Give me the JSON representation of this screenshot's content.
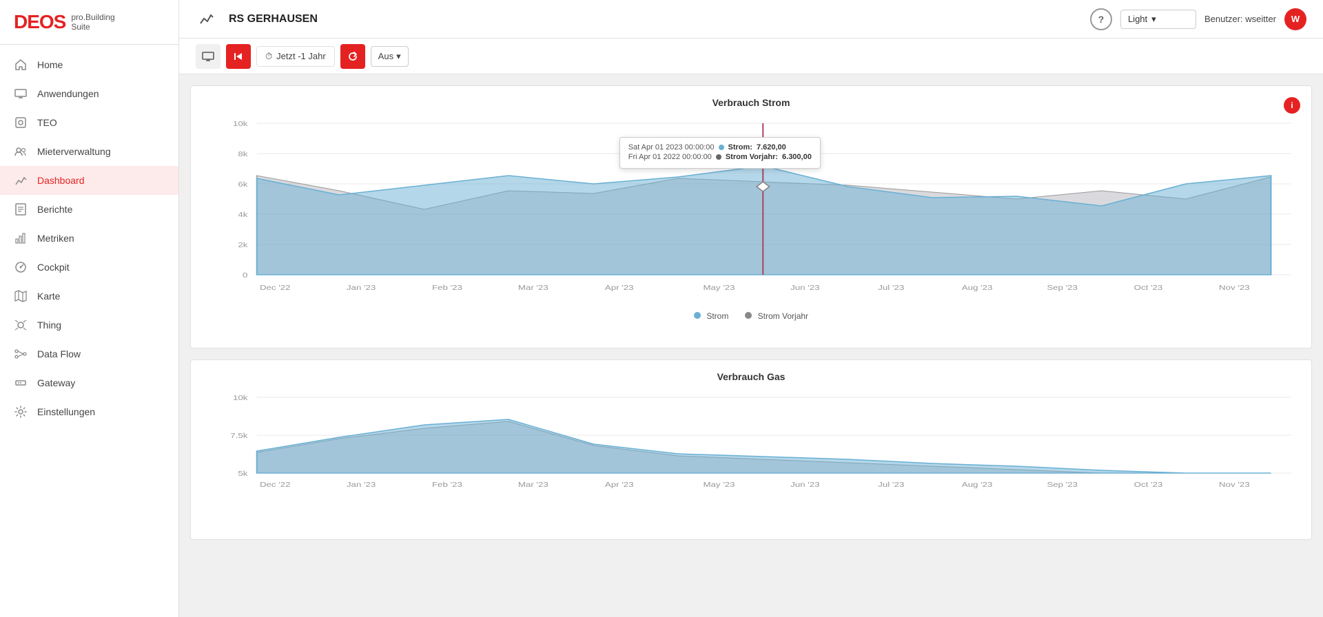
{
  "sidebar": {
    "logo": {
      "brand": "DEOS",
      "line1": "pro.Building",
      "line2": "Suite"
    },
    "nav": [
      {
        "id": "home",
        "label": "Home",
        "icon": "home"
      },
      {
        "id": "anwendungen",
        "label": "Anwendungen",
        "icon": "monitor"
      },
      {
        "id": "teo",
        "label": "TEO",
        "icon": "teo"
      },
      {
        "id": "mieterverwaltung",
        "label": "Mieterverwaltung",
        "icon": "users"
      },
      {
        "id": "dashboard",
        "label": "Dashboard",
        "icon": "chart"
      },
      {
        "id": "berichte",
        "label": "Berichte",
        "icon": "reports"
      },
      {
        "id": "metriken",
        "label": "Metriken",
        "icon": "metrics"
      },
      {
        "id": "cockpit",
        "label": "Cockpit",
        "icon": "cockpit"
      },
      {
        "id": "karte",
        "label": "Karte",
        "icon": "map"
      },
      {
        "id": "thing",
        "label": "Thing",
        "icon": "thing"
      },
      {
        "id": "dataflow",
        "label": "Data Flow",
        "icon": "dataflow"
      },
      {
        "id": "gateway",
        "label": "Gateway",
        "icon": "gateway"
      },
      {
        "id": "einstellungen",
        "label": "Einstellungen",
        "icon": "settings"
      }
    ]
  },
  "topbar": {
    "title": "RS GERHAUSEN",
    "theme_label": "Light",
    "theme_arrow": "▾",
    "user_label": "Benutzer: wseitter",
    "user_initials": "W"
  },
  "toolbar": {
    "time_icon": "⏱",
    "time_label": "Jetzt -1 Jahr",
    "aus_label": "Aus",
    "aus_arrow": "▾"
  },
  "charts": [
    {
      "id": "strom",
      "title": "Verbrauch Strom",
      "legend": [
        {
          "label": "Strom",
          "color": "#6ab0d4"
        },
        {
          "label": "Strom Vorjahr",
          "color": "#888"
        }
      ],
      "tooltip": {
        "row1_date": "Sat Apr 01 2023 00:00:00",
        "row1_label": "Strom:",
        "row1_value": "7.620,00",
        "row1_color": "#6ab0d4",
        "row2_date": "Fri Apr 01 2022 00:00:00",
        "row2_label": "Strom Vorjahr:",
        "row2_value": "6.300,00",
        "row2_color": "#666"
      },
      "yaxis": [
        "10k",
        "8k",
        "6k",
        "4k",
        "2k",
        "0"
      ],
      "xaxis": [
        "Dec '22",
        "Jan '23",
        "Feb '23",
        "Mar '23",
        "Apr '23",
        "May '23",
        "Jun '23",
        "Jul '23",
        "Aug '23",
        "Sep '23",
        "Oct '23",
        "Nov '23"
      ]
    },
    {
      "id": "gas",
      "title": "Verbrauch Gas",
      "yaxis": [
        "10k",
        "7.5k",
        "5k"
      ],
      "xaxis": [
        "Dec '22",
        "Jan '23",
        "Feb '23",
        "Mar '23",
        "Apr '23",
        "May '23",
        "Jun '23",
        "Jul '23",
        "Aug '23",
        "Sep '23",
        "Oct '23",
        "Nov '23"
      ]
    }
  ]
}
